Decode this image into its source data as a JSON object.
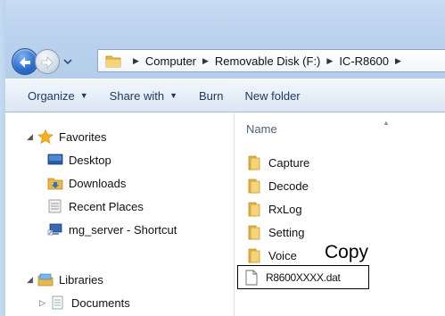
{
  "address_bar": {
    "segments": [
      "Computer",
      "Removable Disk (F:)",
      "IC-R8600"
    ],
    "folder_icon": "folder-icon"
  },
  "toolbar": {
    "organize_label": "Organize",
    "share_label": "Share with",
    "burn_label": "Burn",
    "new_folder_label": "New folder"
  },
  "nav_pane": {
    "favorites": {
      "label": "Favorites",
      "icon": "star-icon",
      "items": [
        {
          "label": "Desktop",
          "icon": "desktop-icon"
        },
        {
          "label": "Downloads",
          "icon": "downloads-folder-icon"
        },
        {
          "label": "Recent Places",
          "icon": "recent-places-icon"
        },
        {
          "label": "mg_server - Shortcut",
          "icon": "network-shortcut-icon"
        }
      ]
    },
    "libraries": {
      "label": "Libraries",
      "icon": "libraries-icon",
      "items": [
        {
          "label": "Documents",
          "icon": "documents-icon"
        }
      ]
    }
  },
  "content": {
    "column_header": "Name",
    "folders": [
      {
        "name": "Capture"
      },
      {
        "name": "Decode"
      },
      {
        "name": "RxLog"
      },
      {
        "name": "Setting"
      },
      {
        "name": "Voice"
      }
    ],
    "annotation": "Copy",
    "dat_file": "R8600XXXX.dat"
  },
  "colors": {
    "accent": "#2e6fd1",
    "toolbar_text": "#1e395b",
    "folder": "#e8b84a"
  }
}
